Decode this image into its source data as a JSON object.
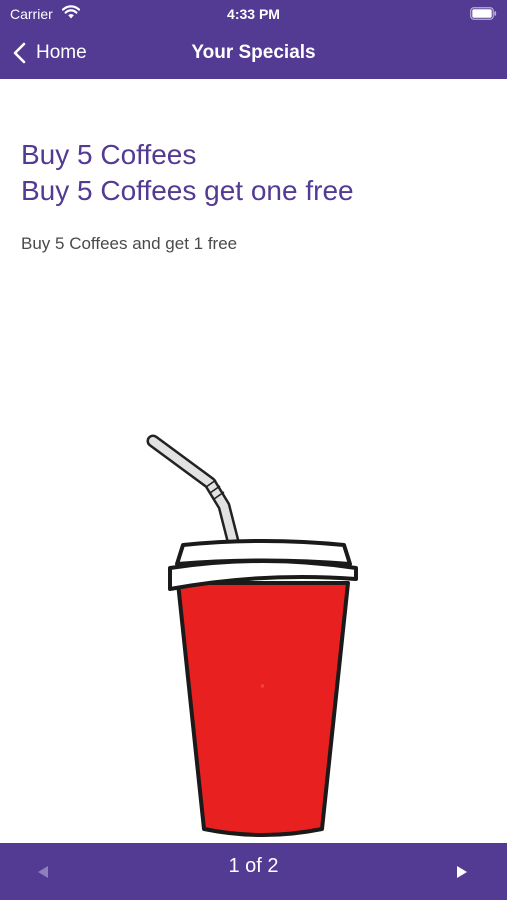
{
  "status_bar": {
    "carrier": "Carrier",
    "time": "4:33 PM",
    "icons": [
      "wifi-icon",
      "battery-icon"
    ]
  },
  "nav": {
    "back_label": "Home",
    "title": "Your Specials",
    "back_icon": "chevron-left-icon"
  },
  "special": {
    "title_line1": "Buy 5 Coffees",
    "title_line2": "Buy 5 Coffees get one free",
    "description": "Buy 5 Coffees and get 1 free",
    "image": "red-drink-cup-with-straw"
  },
  "pager": {
    "indicator": "1 of 2",
    "prev_icon": "triangle-left-icon",
    "next_icon": "triangle-right-icon",
    "prev_enabled": false,
    "next_enabled": true
  },
  "colors": {
    "brand_purple": "#533a93",
    "cup_red": "#e8201f",
    "text_gray": "#4a4a4a",
    "disabled_arrow": "#8f7fbd"
  }
}
